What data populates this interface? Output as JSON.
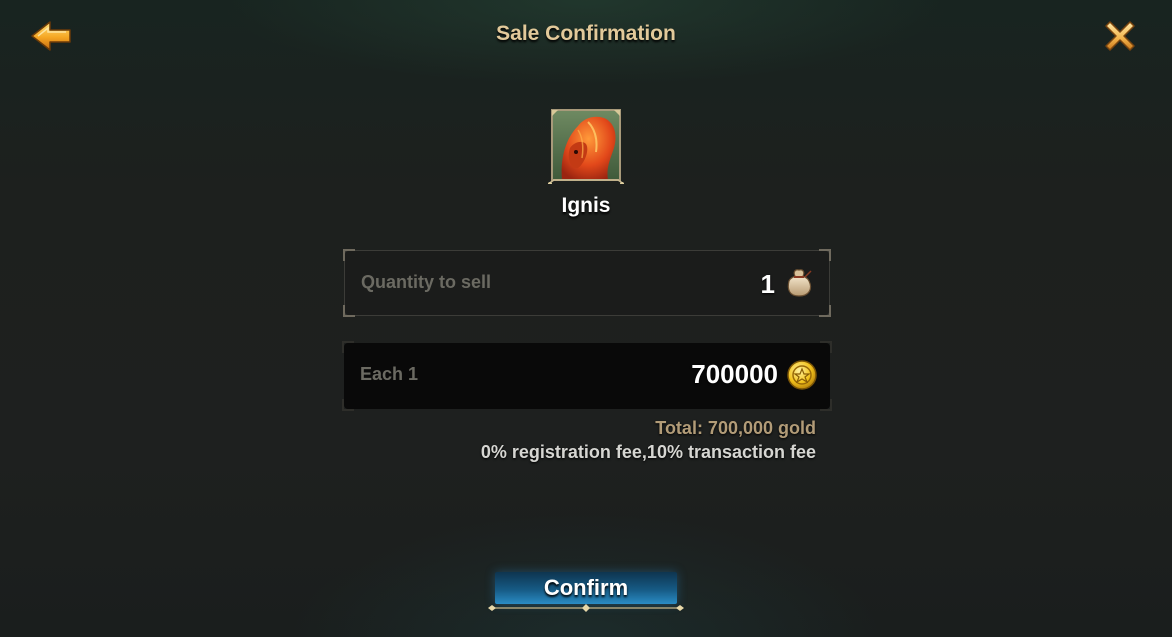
{
  "header": {
    "title": "Sale Confirmation",
    "back_icon": "back-arrow-icon",
    "close_icon": "close-icon"
  },
  "item": {
    "name": "Ignis",
    "icon": "fire-horse-portrait-icon"
  },
  "quantity": {
    "label": "Quantity to sell",
    "value": "1",
    "icon": "sack-icon"
  },
  "price": {
    "label": "Each 1",
    "value": "700000",
    "icon": "gold-coin-icon"
  },
  "summary": {
    "total": "Total: 700,000 gold",
    "fees": "0% registration fee,10% transaction fee"
  },
  "footer": {
    "confirm_label": "Confirm"
  },
  "colors": {
    "title": "#e2c99a",
    "accent_gold": "#f2a91c",
    "confirm_blue": "#2a8cc4",
    "total_text": "#b29c78"
  }
}
